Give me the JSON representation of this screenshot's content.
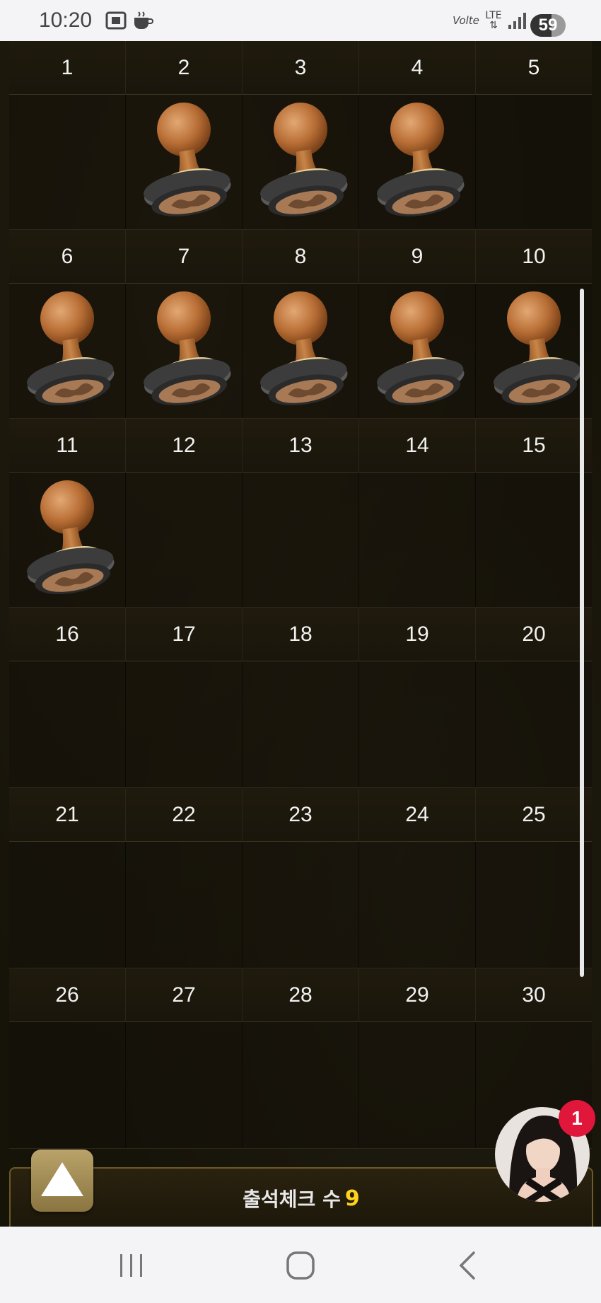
{
  "status_bar": {
    "time": "10:20",
    "network": "LTE",
    "volte": "Volte",
    "battery": "59"
  },
  "calendar": {
    "stamped_days": [
      2,
      3,
      4,
      6,
      7,
      8,
      9,
      10,
      11
    ],
    "weeks": [
      [
        1,
        2,
        3,
        4,
        5
      ],
      [
        6,
        7,
        8,
        9,
        10
      ],
      [
        11,
        12,
        13,
        14,
        15
      ],
      [
        16,
        17,
        18,
        19,
        20
      ],
      [
        21,
        22,
        23,
        24,
        25
      ],
      [
        26,
        27,
        28,
        29,
        30
      ]
    ]
  },
  "footer": {
    "label": "출석체크 수",
    "count": "9"
  },
  "chat": {
    "badge_count": "1"
  },
  "colors": {
    "accent_gold": "#b9a36a",
    "count_yellow": "#ffd21f",
    "badge_red": "#e0163a"
  }
}
